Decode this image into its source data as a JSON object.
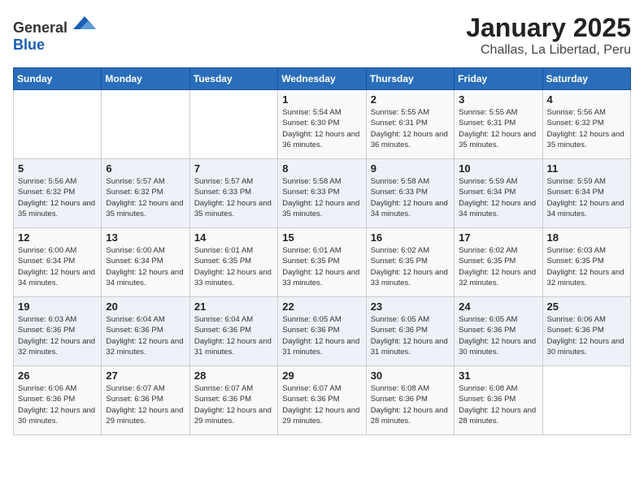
{
  "header": {
    "logo": {
      "general": "General",
      "blue": "Blue"
    },
    "month": "January 2025",
    "location": "Challas, La Libertad, Peru"
  },
  "weekdays": [
    "Sunday",
    "Monday",
    "Tuesday",
    "Wednesday",
    "Thursday",
    "Friday",
    "Saturday"
  ],
  "weeks": [
    [
      {
        "day": "",
        "info": ""
      },
      {
        "day": "",
        "info": ""
      },
      {
        "day": "",
        "info": ""
      },
      {
        "day": "1",
        "info": "Sunrise: 5:54 AM\nSunset: 6:30 PM\nDaylight: 12 hours\nand 36 minutes."
      },
      {
        "day": "2",
        "info": "Sunrise: 5:55 AM\nSunset: 6:31 PM\nDaylight: 12 hours\nand 36 minutes."
      },
      {
        "day": "3",
        "info": "Sunrise: 5:55 AM\nSunset: 6:31 PM\nDaylight: 12 hours\nand 35 minutes."
      },
      {
        "day": "4",
        "info": "Sunrise: 5:56 AM\nSunset: 6:32 PM\nDaylight: 12 hours\nand 35 minutes."
      }
    ],
    [
      {
        "day": "5",
        "info": "Sunrise: 5:56 AM\nSunset: 6:32 PM\nDaylight: 12 hours\nand 35 minutes."
      },
      {
        "day": "6",
        "info": "Sunrise: 5:57 AM\nSunset: 6:32 PM\nDaylight: 12 hours\nand 35 minutes."
      },
      {
        "day": "7",
        "info": "Sunrise: 5:57 AM\nSunset: 6:33 PM\nDaylight: 12 hours\nand 35 minutes."
      },
      {
        "day": "8",
        "info": "Sunrise: 5:58 AM\nSunset: 6:33 PM\nDaylight: 12 hours\nand 35 minutes."
      },
      {
        "day": "9",
        "info": "Sunrise: 5:58 AM\nSunset: 6:33 PM\nDaylight: 12 hours\nand 34 minutes."
      },
      {
        "day": "10",
        "info": "Sunrise: 5:59 AM\nSunset: 6:34 PM\nDaylight: 12 hours\nand 34 minutes."
      },
      {
        "day": "11",
        "info": "Sunrise: 5:59 AM\nSunset: 6:34 PM\nDaylight: 12 hours\nand 34 minutes."
      }
    ],
    [
      {
        "day": "12",
        "info": "Sunrise: 6:00 AM\nSunset: 6:34 PM\nDaylight: 12 hours\nand 34 minutes."
      },
      {
        "day": "13",
        "info": "Sunrise: 6:00 AM\nSunset: 6:34 PM\nDaylight: 12 hours\nand 34 minutes."
      },
      {
        "day": "14",
        "info": "Sunrise: 6:01 AM\nSunset: 6:35 PM\nDaylight: 12 hours\nand 33 minutes."
      },
      {
        "day": "15",
        "info": "Sunrise: 6:01 AM\nSunset: 6:35 PM\nDaylight: 12 hours\nand 33 minutes."
      },
      {
        "day": "16",
        "info": "Sunrise: 6:02 AM\nSunset: 6:35 PM\nDaylight: 12 hours\nand 33 minutes."
      },
      {
        "day": "17",
        "info": "Sunrise: 6:02 AM\nSunset: 6:35 PM\nDaylight: 12 hours\nand 32 minutes."
      },
      {
        "day": "18",
        "info": "Sunrise: 6:03 AM\nSunset: 6:35 PM\nDaylight: 12 hours\nand 32 minutes."
      }
    ],
    [
      {
        "day": "19",
        "info": "Sunrise: 6:03 AM\nSunset: 6:36 PM\nDaylight: 12 hours\nand 32 minutes."
      },
      {
        "day": "20",
        "info": "Sunrise: 6:04 AM\nSunset: 6:36 PM\nDaylight: 12 hours\nand 32 minutes."
      },
      {
        "day": "21",
        "info": "Sunrise: 6:04 AM\nSunset: 6:36 PM\nDaylight: 12 hours\nand 31 minutes."
      },
      {
        "day": "22",
        "info": "Sunrise: 6:05 AM\nSunset: 6:36 PM\nDaylight: 12 hours\nand 31 minutes."
      },
      {
        "day": "23",
        "info": "Sunrise: 6:05 AM\nSunset: 6:36 PM\nDaylight: 12 hours\nand 31 minutes."
      },
      {
        "day": "24",
        "info": "Sunrise: 6:05 AM\nSunset: 6:36 PM\nDaylight: 12 hours\nand 30 minutes."
      },
      {
        "day": "25",
        "info": "Sunrise: 6:06 AM\nSunset: 6:36 PM\nDaylight: 12 hours\nand 30 minutes."
      }
    ],
    [
      {
        "day": "26",
        "info": "Sunrise: 6:06 AM\nSunset: 6:36 PM\nDaylight: 12 hours\nand 30 minutes."
      },
      {
        "day": "27",
        "info": "Sunrise: 6:07 AM\nSunset: 6:36 PM\nDaylight: 12 hours\nand 29 minutes."
      },
      {
        "day": "28",
        "info": "Sunrise: 6:07 AM\nSunset: 6:36 PM\nDaylight: 12 hours\nand 29 minutes."
      },
      {
        "day": "29",
        "info": "Sunrise: 6:07 AM\nSunset: 6:36 PM\nDaylight: 12 hours\nand 29 minutes."
      },
      {
        "day": "30",
        "info": "Sunrise: 6:08 AM\nSunset: 6:36 PM\nDaylight: 12 hours\nand 28 minutes."
      },
      {
        "day": "31",
        "info": "Sunrise: 6:08 AM\nSunset: 6:36 PM\nDaylight: 12 hours\nand 28 minutes."
      },
      {
        "day": "",
        "info": ""
      }
    ]
  ]
}
